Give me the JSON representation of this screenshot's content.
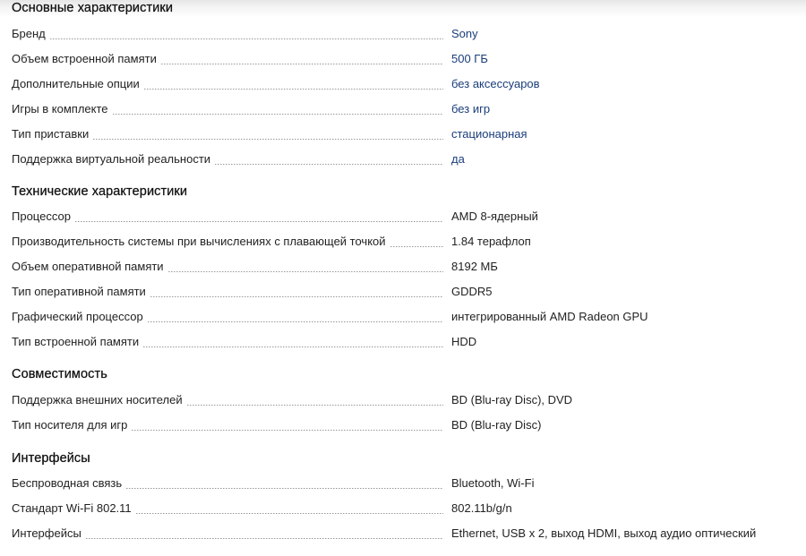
{
  "sections": [
    {
      "title": "Основные характеристики",
      "rows": [
        {
          "name": "Бренд",
          "value": "Sony",
          "link": true
        },
        {
          "name": "Объем встроенной памяти",
          "value": "500 ГБ",
          "link": true
        },
        {
          "name": "Дополнительные опции",
          "value": "без аксессуаров",
          "link": true
        },
        {
          "name": "Игры в комплекте",
          "value": "без игр",
          "link": true
        },
        {
          "name": "Тип приставки",
          "value": "стационарная",
          "link": true
        },
        {
          "name": "Поддержка виртуальной реальности",
          "value": "да",
          "link": true
        }
      ]
    },
    {
      "title": "Технические характеристики",
      "rows": [
        {
          "name": "Процессор",
          "value": "AMD 8-ядерный",
          "link": false
        },
        {
          "name": "Производительность системы при вычислениях с плавающей точкой",
          "value": "1.84 терафлоп",
          "link": false
        },
        {
          "name": "Объем оперативной памяти",
          "value": "8192 МБ",
          "link": false
        },
        {
          "name": "Тип оперативной памяти",
          "value": "GDDR5",
          "link": false
        },
        {
          "name": "Графический процессор",
          "value": "интегрированный AMD Radeon GPU",
          "link": false
        },
        {
          "name": "Тип встроенной памяти",
          "value": "HDD",
          "link": false
        }
      ]
    },
    {
      "title": "Совместимость",
      "rows": [
        {
          "name": "Поддержка внешних носителей",
          "value": "BD (Blu-ray Disc), DVD",
          "link": false
        },
        {
          "name": "Тип носителя для игр",
          "value": "BD (Blu-ray Disc)",
          "link": false
        }
      ]
    },
    {
      "title": "Интерфейсы",
      "rows": [
        {
          "name": "Беспроводная связь",
          "value": "Bluetooth, Wi-Fi",
          "link": false
        },
        {
          "name": "Стандарт Wi-Fi 802.11",
          "value": "802.11b/g/n",
          "link": false
        },
        {
          "name": "Интерфейсы",
          "value": "Ethernet, USB x 2, выход HDMI, выход аудио оптический",
          "link": false
        }
      ]
    }
  ]
}
